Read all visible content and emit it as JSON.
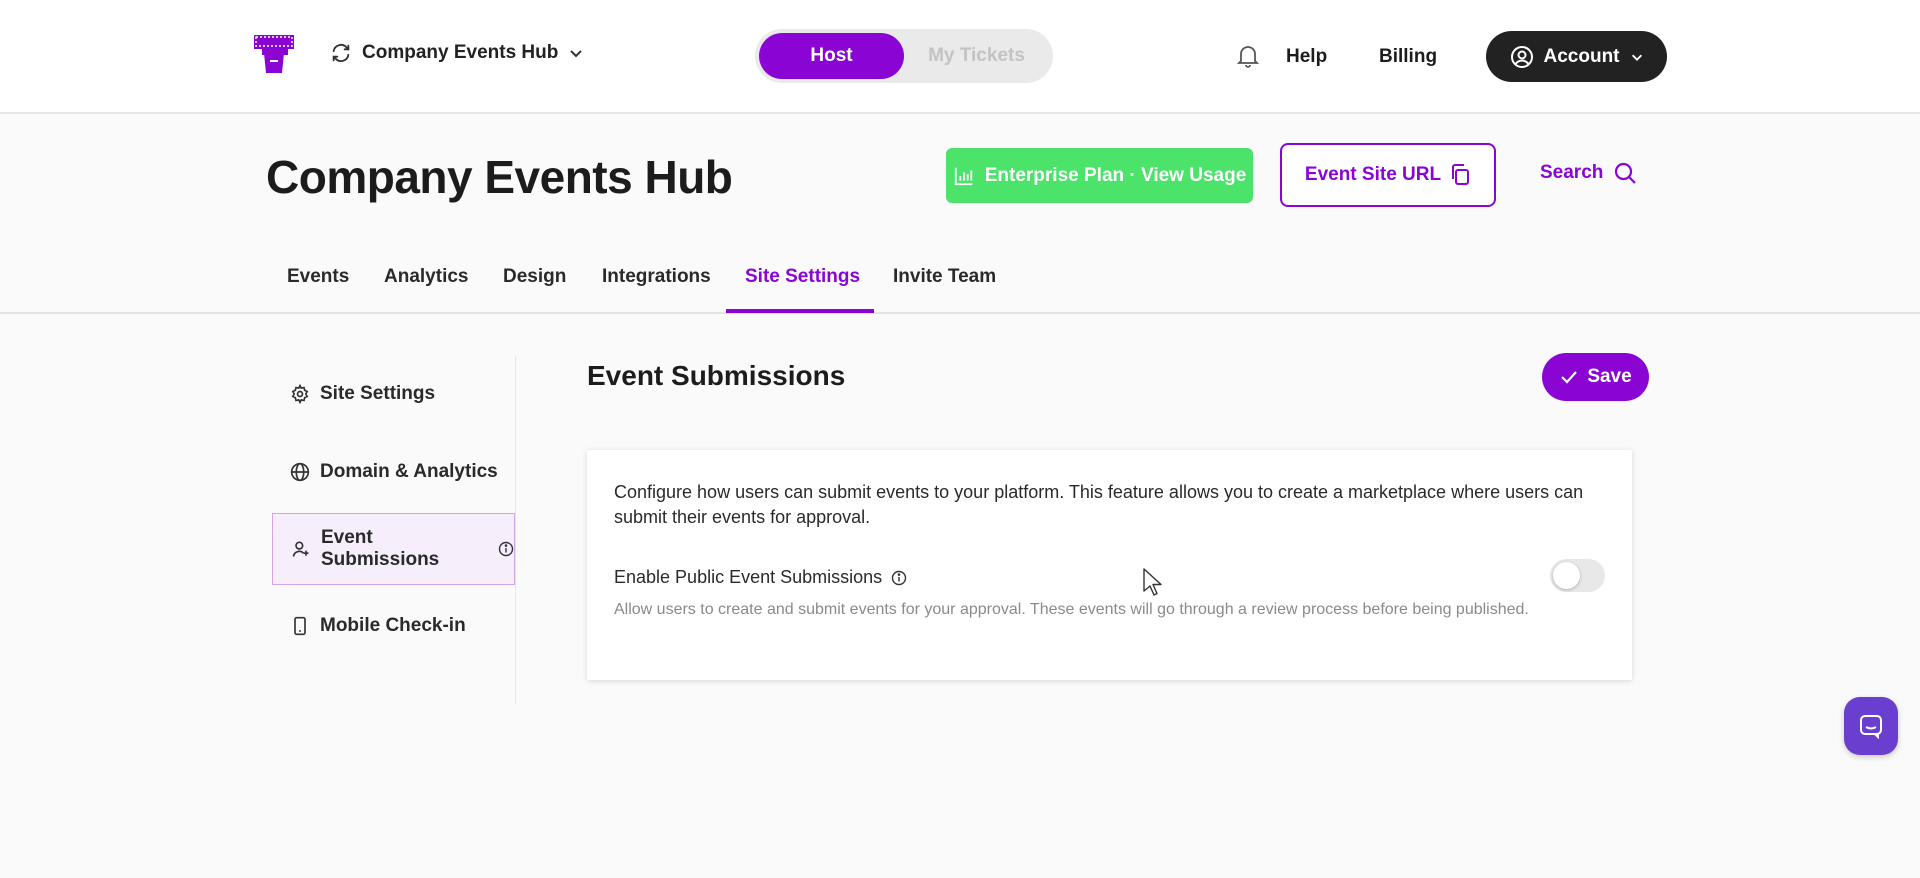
{
  "topbar": {
    "workspace_name": "Company Events Hub",
    "mode_tabs": [
      {
        "label": "Host",
        "active": true
      },
      {
        "label": "My Tickets",
        "active": false
      }
    ],
    "help_label": "Help",
    "billing_label": "Billing",
    "account_label": "Account"
  },
  "header": {
    "title": "Company Events Hub",
    "plan_button": "Enterprise Plan · View Usage",
    "site_url_button": "Event Site URL",
    "search_label": "Search"
  },
  "tabs": [
    {
      "label": "Events"
    },
    {
      "label": "Analytics"
    },
    {
      "label": "Design"
    },
    {
      "label": "Integrations"
    },
    {
      "label": "Site Settings",
      "active": true
    },
    {
      "label": "Invite Team"
    }
  ],
  "sidebar": {
    "items": [
      {
        "label": "Site Settings",
        "icon": "gear-icon"
      },
      {
        "label": "Domain & Analytics",
        "icon": "globe-icon"
      },
      {
        "label": "Event Submissions",
        "icon": "user-plus-icon",
        "active": true
      },
      {
        "label": "Mobile Check-in",
        "icon": "phone-icon"
      }
    ]
  },
  "main": {
    "section_title": "Event Submissions",
    "save_label": "Save",
    "description": "Configure how users can submit events to your platform. This feature allows you to create a marketplace where users can submit their events for approval.",
    "option": {
      "label": "Enable Public Event Submissions",
      "help": "Allow users to create and submit events for your approval. These events will go through a review process before being published.",
      "enabled": false
    }
  },
  "colors": {
    "brand_purple": "#8a05d4",
    "plan_green": "#4be36a",
    "account_dark": "#222222",
    "chat_purple": "#6a3fcf"
  }
}
